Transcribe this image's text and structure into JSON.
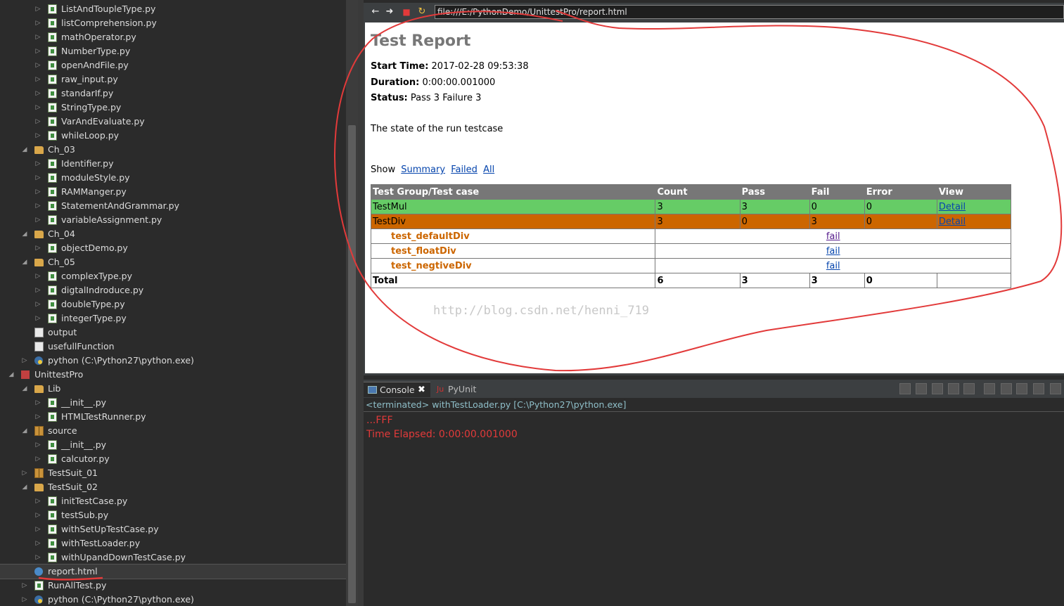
{
  "explorer": {
    "rows": [
      {
        "label": "ListAndToupleType.py",
        "indent": 1,
        "icon": "python-file-icon",
        "expander": "collapsed"
      },
      {
        "label": "listComprehension.py",
        "indent": 1,
        "icon": "python-file-icon",
        "expander": "collapsed"
      },
      {
        "label": "mathOperator.py",
        "indent": 1,
        "icon": "python-file-icon",
        "expander": "collapsed"
      },
      {
        "label": "NumberType.py",
        "indent": 1,
        "icon": "python-file-icon",
        "expander": "collapsed"
      },
      {
        "label": "openAndFile.py",
        "indent": 1,
        "icon": "python-file-icon",
        "expander": "collapsed"
      },
      {
        "label": "raw_input.py",
        "indent": 1,
        "icon": "python-file-icon",
        "expander": "collapsed"
      },
      {
        "label": "standarIf.py",
        "indent": 1,
        "icon": "python-file-icon",
        "expander": "collapsed"
      },
      {
        "label": "StringType.py",
        "indent": 1,
        "icon": "python-file-icon",
        "expander": "collapsed"
      },
      {
        "label": "VarAndEvaluate.py",
        "indent": 1,
        "icon": "python-file-icon",
        "expander": "collapsed"
      },
      {
        "label": "whileLoop.py",
        "indent": 1,
        "icon": "python-file-icon",
        "expander": "collapsed"
      },
      {
        "label": "Ch_03",
        "indent": 0,
        "icon": "folder-icon",
        "expander": "expanded"
      },
      {
        "label": "Identifier.py",
        "indent": 1,
        "icon": "python-file-icon",
        "expander": "collapsed"
      },
      {
        "label": "moduleStyle.py",
        "indent": 1,
        "icon": "python-file-icon",
        "expander": "collapsed"
      },
      {
        "label": "RAMManger.py",
        "indent": 1,
        "icon": "python-file-icon",
        "expander": "collapsed"
      },
      {
        "label": "StatementAndGrammar.py",
        "indent": 1,
        "icon": "python-file-icon",
        "expander": "collapsed"
      },
      {
        "label": "variableAssignment.py",
        "indent": 1,
        "icon": "python-file-icon",
        "expander": "collapsed"
      },
      {
        "label": "Ch_04",
        "indent": 0,
        "icon": "folder-icon",
        "expander": "expanded"
      },
      {
        "label": "objectDemo.py",
        "indent": 1,
        "icon": "python-file-icon",
        "expander": "collapsed"
      },
      {
        "label": "Ch_05",
        "indent": 0,
        "icon": "folder-icon",
        "expander": "expanded"
      },
      {
        "label": "complexType.py",
        "indent": 1,
        "icon": "python-file-icon",
        "expander": "collapsed"
      },
      {
        "label": "digtalIndroduce.py",
        "indent": 1,
        "icon": "python-file-icon",
        "expander": "collapsed"
      },
      {
        "label": "doubleType.py",
        "indent": 1,
        "icon": "python-file-icon",
        "expander": "collapsed"
      },
      {
        "label": "integerType.py",
        "indent": 1,
        "icon": "python-file-icon",
        "expander": "collapsed"
      },
      {
        "label": "output",
        "indent": 0,
        "icon": "text-file-icon",
        "expander": "none"
      },
      {
        "label": "usefullFunction",
        "indent": 0,
        "icon": "text-file-icon",
        "expander": "none"
      },
      {
        "label": "python  (C:\\Python27\\python.exe)",
        "indent": 0,
        "icon": "python-interpreter-icon",
        "expander": "collapsed"
      },
      {
        "label": "UnittestPro",
        "indent": -1,
        "icon": "project-icon",
        "expander": "expanded"
      },
      {
        "label": "Lib",
        "indent": 0,
        "icon": "folder-icon",
        "expander": "expanded"
      },
      {
        "label": "__init__.py",
        "indent": 1,
        "icon": "python-file-icon",
        "expander": "collapsed"
      },
      {
        "label": "HTMLTestRunner.py",
        "indent": 1,
        "icon": "python-file-icon",
        "expander": "collapsed"
      },
      {
        "label": "source",
        "indent": 0,
        "icon": "package-icon",
        "expander": "expanded"
      },
      {
        "label": "__init__.py",
        "indent": 1,
        "icon": "python-file-icon",
        "expander": "collapsed"
      },
      {
        "label": "calcutor.py",
        "indent": 1,
        "icon": "python-file-icon",
        "expander": "collapsed"
      },
      {
        "label": "TestSuit_01",
        "indent": 0,
        "icon": "package-icon",
        "expander": "collapsed"
      },
      {
        "label": "TestSuit_02",
        "indent": 0,
        "icon": "folder-icon",
        "expander": "expanded"
      },
      {
        "label": "initTestCase.py",
        "indent": 1,
        "icon": "python-file-icon",
        "expander": "collapsed"
      },
      {
        "label": "testSub.py",
        "indent": 1,
        "icon": "python-file-icon",
        "expander": "collapsed"
      },
      {
        "label": "withSetUpTestCase.py",
        "indent": 1,
        "icon": "python-file-icon",
        "expander": "collapsed"
      },
      {
        "label": "withTestLoader.py",
        "indent": 1,
        "icon": "python-file-icon",
        "expander": "collapsed"
      },
      {
        "label": "withUpandDownTestCase.py",
        "indent": 1,
        "icon": "python-file-icon",
        "expander": "collapsed"
      },
      {
        "label": "report.html",
        "indent": 0,
        "icon": "html-file-icon",
        "expander": "none",
        "selected": true
      },
      {
        "label": "RunAllTest.py",
        "indent": 0,
        "icon": "python-file-icon",
        "expander": "collapsed"
      },
      {
        "label": "python  (C:\\Python27\\python.exe)",
        "indent": 0,
        "icon": "python-interpreter-icon",
        "expander": "collapsed"
      }
    ]
  },
  "browser": {
    "url": "file:///E:/PythonDemo/UnittestPro/report.html",
    "nav_icons": [
      "back-icon",
      "forward-icon",
      "stop-icon",
      "refresh-icon"
    ]
  },
  "report": {
    "title": "Test Report",
    "start_time_label": "Start Time:",
    "start_time": "2017-02-28 09:53:38",
    "duration_label": "Duration:",
    "duration": "0:00:00.001000",
    "status_label": "Status:",
    "status": "Pass 3 Failure 3",
    "description": "The state of the run testcase",
    "show_label": "Show",
    "show_links": [
      "Summary",
      "Failed",
      "All"
    ],
    "headers": [
      "Test Group/Test case",
      "Count",
      "Pass",
      "Fail",
      "Error",
      "View"
    ],
    "groups": [
      {
        "name": "TestMul",
        "count": "3",
        "pass": "3",
        "fail": "0",
        "error": "0",
        "view": "Detail",
        "status": "pass"
      },
      {
        "name": "TestDiv",
        "count": "3",
        "pass": "0",
        "fail": "3",
        "error": "0",
        "view": "Detail",
        "status": "fail"
      }
    ],
    "cases": [
      {
        "name": "test_defaultDiv",
        "result": "fail"
      },
      {
        "name": "test_floatDiv",
        "result": "fail"
      },
      {
        "name": "test_negtiveDiv",
        "result": "fail"
      }
    ],
    "total": {
      "label": "Total",
      "count": "6",
      "pass": "3",
      "fail": "3",
      "error": "0"
    },
    "watermark": "http://blog.csdn.net/henni_719"
  },
  "console": {
    "tab_console": "Console",
    "tab_pyunit": "PyUnit",
    "status_line": "<terminated> withTestLoader.py [C:\\Python27\\python.exe]",
    "output": [
      "...FFF",
      "Time Elapsed: 0:00:00.001000"
    ]
  },
  "colors": {
    "pass_row": "#66cc66",
    "fail_row": "#cc6600",
    "annotation": "#e23a3a"
  }
}
